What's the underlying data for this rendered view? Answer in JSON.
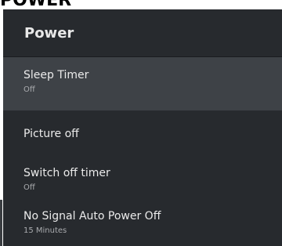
{
  "page_heading": "POWER",
  "panel": {
    "title": "Power",
    "items": [
      {
        "label": "Sleep Timer",
        "value": "Off",
        "focused": true
      },
      {
        "label": "Picture off",
        "value": ""
      },
      {
        "label": "Switch off timer",
        "value": "Off"
      },
      {
        "label": "No Signal Auto Power Off",
        "value": "15 Minutes"
      }
    ]
  },
  "colors": {
    "panel_background": "#272a2e",
    "focused_background": "#3e4247",
    "label_text": "#ebebeb",
    "value_text": "#a9abae",
    "heading_text": "#000000"
  }
}
